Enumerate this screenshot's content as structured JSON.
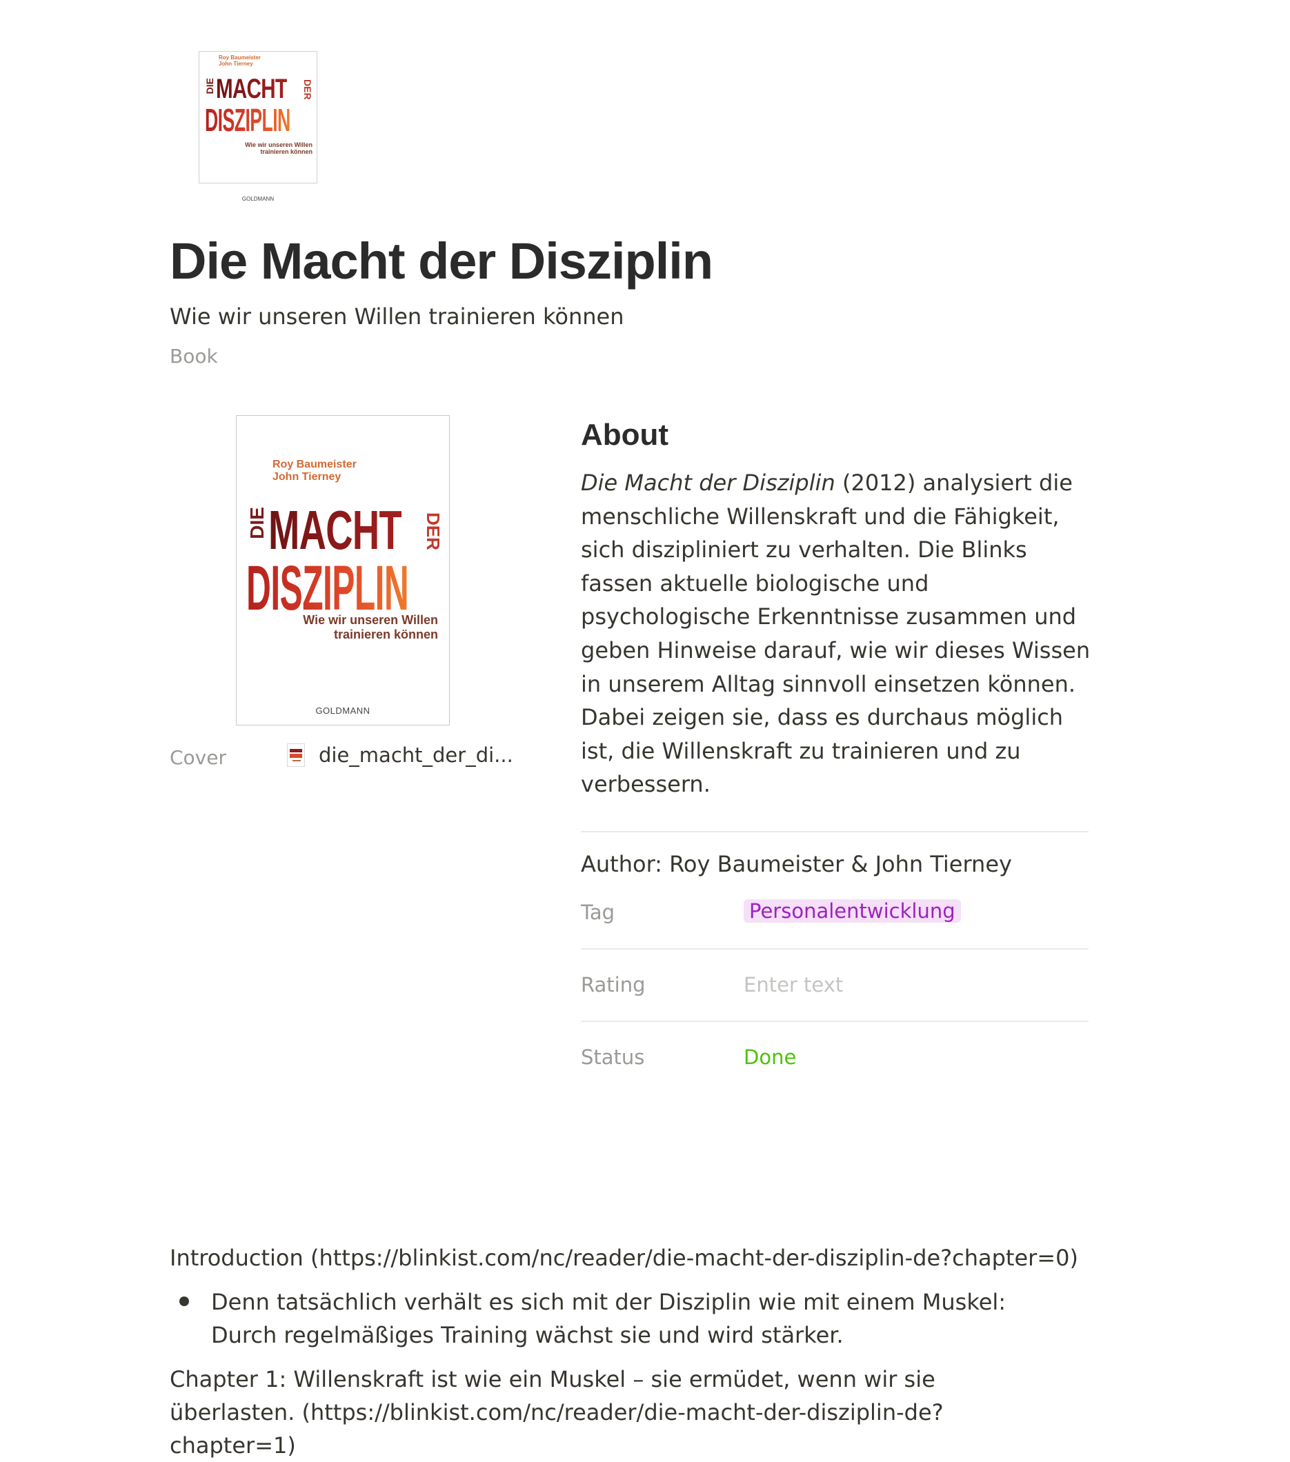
{
  "page": {
    "title": "Die Macht der Disziplin",
    "subtitle": "Wie wir unseren Willen trainieren können",
    "type": "Book"
  },
  "cover_art": {
    "authors": "Roy Baumeister\nJohn Tierney",
    "word_die": "DIE",
    "word_macht": "MACHT",
    "word_der": "DER",
    "word_disziplin": "DISZIPLIN",
    "tagline": "Wie wir unseren Willen\ntrainieren können",
    "publisher": "GOLDMANN",
    "colors": {
      "dark_red": "#7a1b1b",
      "red": "#c0392b",
      "orange": "#f07a2c"
    }
  },
  "properties_left": {
    "cover_label": "Cover",
    "cover_file": "die_macht_der_di..."
  },
  "about": {
    "heading": "About",
    "italic_title": "Die Macht der Disziplin",
    "text": " (2012) analysiert die menschliche Willenskraft und die Fähigkeit, sich diszipliniert zu verhalten. Die Blinks fassen aktuelle biologische und psychologische Erkenntnisse zusammen und geben Hinweise darauf, wie wir dieses Wissen in unserem Alltag sinnvoll einsetzen können. Dabei zeigen sie, dass es durchaus möglich ist, die Willenskraft zu trainieren und zu verbessern."
  },
  "properties": {
    "author": "Author: Roy Baumeister & John Tierney",
    "tag_label": "Tag",
    "tag_value": "Personalentwicklung",
    "rating_label": "Rating",
    "rating_placeholder": "Enter text",
    "status_label": "Status",
    "status_value": "Done",
    "colors": {
      "tag_bg": "#f5e0f8",
      "tag_fg": "#a020c0",
      "status": "#4cc20a"
    }
  },
  "content": {
    "intro": "Introduction (https://blinkist.com/nc/reader/die-macht-der-disziplin-de?chapter=0)",
    "bullet_1": "Denn tatsächlich verhält es sich mit der Disziplin wie mit einem Muskel: Durch regelmäßiges Training wächst sie und wird stärker.",
    "chapter_1": "Chapter 1: Willenskraft ist wie ein Muskel – sie ermüdet, wenn wir sie überlasten. (https://blinkist.com/nc/reader/die-macht-der-disziplin-de?chapter=1)"
  }
}
